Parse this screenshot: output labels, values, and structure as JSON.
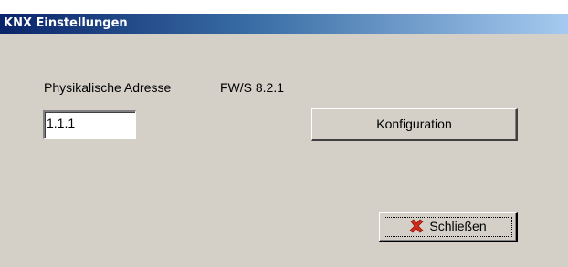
{
  "window": {
    "title": "KNX Einstellungen"
  },
  "form": {
    "address_label": "Physikalische Adresse",
    "device_label": "FW/S 8.2.1",
    "address_value": "1.1.1"
  },
  "buttons": {
    "config_label": "Konfiguration",
    "close_label": "Schließen",
    "close_icon": "close-x-icon"
  },
  "colors": {
    "title_bar": "#0a246a",
    "dialog_bg": "#d4d0c8",
    "close_icon": "#d62a1a"
  }
}
